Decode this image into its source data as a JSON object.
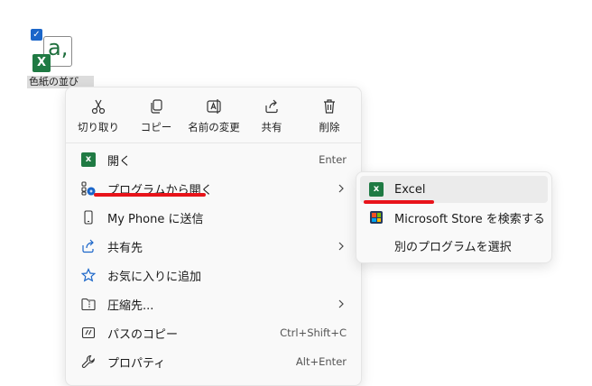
{
  "desktop": {
    "file": {
      "badge": "X",
      "doc_letter": "a,",
      "label": "色紙の並び"
    }
  },
  "quick_actions": [
    {
      "id": "cut",
      "label": "切り取り",
      "icon": "scissors-icon"
    },
    {
      "id": "copy",
      "label": "コピー",
      "icon": "copy-icon"
    },
    {
      "id": "rename",
      "label": "名前の変更",
      "icon": "rename-icon"
    },
    {
      "id": "share",
      "label": "共有",
      "icon": "share-icon"
    },
    {
      "id": "delete",
      "label": "削除",
      "icon": "trash-icon"
    }
  ],
  "menu": {
    "items": [
      {
        "label": "開く",
        "shortcut": "Enter",
        "icon": "excel-icon"
      },
      {
        "label": "プログラムから開く",
        "icon": "open-with-icon"
      },
      {
        "label": "My Phone に送信",
        "icon": "phone-icon"
      },
      {
        "label": "共有先",
        "icon": "share-to-icon"
      },
      {
        "label": "お気に入りに追加",
        "icon": "star-icon"
      },
      {
        "label": "圧縮先...",
        "icon": "zip-folder-icon"
      },
      {
        "label": "パスのコピー",
        "shortcut": "Ctrl+Shift+C",
        "icon": "copy-path-icon"
      },
      {
        "label": "プロパティ",
        "shortcut": "Alt+Enter",
        "icon": "wrench-icon"
      }
    ]
  },
  "submenu": {
    "items": [
      {
        "label": "Excel",
        "icon": "excel-icon"
      },
      {
        "label": "Microsoft Store を検索する",
        "icon": "store-icon"
      },
      {
        "label": "別のプログラムを選択",
        "icon": ""
      }
    ]
  },
  "colors": {
    "annotation": "#e8131a",
    "excel_green": "#1f7a43",
    "accent_blue": "#1b66c9",
    "menu_bg": "#f9f9f9"
  }
}
